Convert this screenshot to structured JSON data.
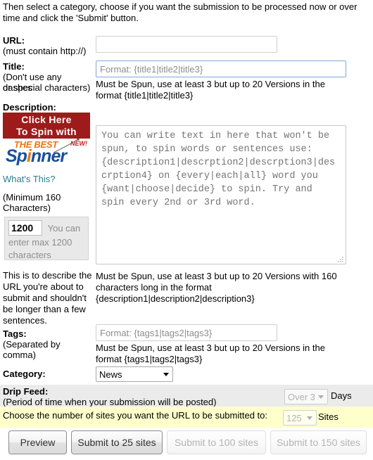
{
  "intro": {
    "text": "Then select a category, choose if you want the submission to be processed now or over time and click the 'Submit' button."
  },
  "url_field": {
    "label": "URL:",
    "note": "(must contain http://)",
    "value": "",
    "placeholder": ""
  },
  "title_field": {
    "label": "Title:",
    "note_line1": "(Don't use any dashes",
    "note_line2": "or special characters)",
    "value": "",
    "placeholder": "Format: {title1|title2|title3}",
    "hint": "Must be Spun, use at least 3 but up to 20 Versions in the format {title1|title2|title3}"
  },
  "description_field": {
    "label": "Description:",
    "min_note_line1": "(Minimum 160",
    "min_note_line2": "Characters)",
    "value": "",
    "placeholder": "You can write text in here that won't be spun, to spin words or sentences use: {description1|descrption2|descrption3|descrption4} on {every|each|all} word you {want|choose|decide} to spin. Try and spin every 2nd or 3rd word.",
    "hint": "Must be Spun, use at least 3 but up to 20 Versions with 160 characters long in the format {description1|description2|description3}",
    "side_note": "This is to describe the URL you're about to submit and shouldn't be longer than a few sentences."
  },
  "char_counter": {
    "value": "1200",
    "text": "You can enter max 1200 characters"
  },
  "spinner_banner": {
    "line1": "Click Here",
    "line2": "To Spin with",
    "best": "THE BEST",
    "new": "NEW!",
    "word_pre": "Sp",
    "word_dot": "i",
    "word_post": "nner",
    "whats_this": "What's This?",
    "color_top_bg": "#9e1b1b",
    "color_best": "#e8751a",
    "color_word": "#1b4f9c",
    "color_new": "#cc2020",
    "link_color": "#2a7f8f"
  },
  "tags_field": {
    "label": "Tags:",
    "note": "(Separated by comma)",
    "value": "",
    "placeholder": "Format: {tags1|tags2|tags3}",
    "hint": "Must be Spun, use at least 3 but up to 20 Versions in the format {tags1|tags2|tags3}"
  },
  "category_field": {
    "label": "Category:",
    "selected": "News",
    "options": [
      "News"
    ]
  },
  "drip_feed": {
    "label": "Drip Feed:",
    "note": "(Period of time when your submission will be posted)",
    "selected": "Over 3",
    "options": [
      "Over 3"
    ],
    "unit": "Days",
    "disabled": true,
    "band_color": "#ebebeb"
  },
  "sites_row": {
    "label": "Choose the number of sites you want the URL to be submitted to:",
    "selected": "125",
    "options": [
      "125"
    ],
    "unit": "Sites",
    "disabled": true,
    "band_color": "#ffffcc"
  },
  "buttons": [
    {
      "label": "Preview",
      "disabled": false
    },
    {
      "label": "Submit to 25 sites",
      "disabled": false
    },
    {
      "label": "Submit to 100 sites",
      "disabled": true
    },
    {
      "label": "Submit to 150 sites",
      "disabled": true
    }
  ]
}
